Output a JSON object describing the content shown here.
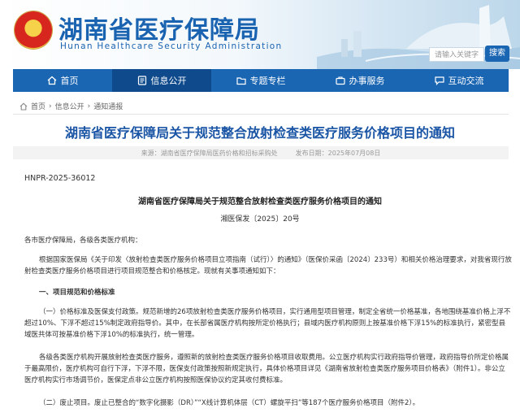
{
  "header": {
    "site_title": "湖南省医疗保障局",
    "site_subtitle": "Hunan Healthcare Security Administration",
    "search_placeholder": "请输入关键字",
    "search_button": "搜索"
  },
  "nav": {
    "items": [
      {
        "label": "首页",
        "icon": "home-icon"
      },
      {
        "label": "信息公开",
        "icon": "list-icon"
      },
      {
        "label": "专题专栏",
        "icon": "folder-icon"
      },
      {
        "label": "办事服务",
        "icon": "briefcase-icon"
      },
      {
        "label": "互动交流",
        "icon": "chat-icon"
      }
    ],
    "active_index": 1
  },
  "breadcrumb": {
    "items": [
      "首页",
      "信息公开",
      "通知通报"
    ],
    "separator": "›"
  },
  "article": {
    "title": "湖南省医疗保障局关于规范整合放射检查类医疗服务价格项目的通知",
    "source": "来源：湖南省医疗保障局医药价格和招标采购处",
    "date": "发布日期：2025年07月08日",
    "doc_number": "HNPR-2025-36012",
    "sub_title": "湖南省医疗保障局关于规范整合放射检查类医疗服务价格项目的通知",
    "file_number": "湘医保发〔2025〕20号",
    "salutation": "各市医疗保障局，各级各类医疗机构：",
    "para1": "根据国家医保局《关于印发〈放射检查类医疗服务价格项目立项指南（试行）〉的通知》（医保价采函〔2024〕233号）和相关价格治理要求，对我省现行放射检查类医疗服务价格项目进行项目规范整合和价格核定。现就有关事项通知如下：",
    "section1": "一、项目规范和价格标准",
    "para2": "（一）价格标准及医保支付政策。规范新增的26项放射检查类医疗服务价格项目，实行通用型项目管理，制定全省统一价格基准，各地围绕基准价格上浮不超过10%、下浮不超过15%制定政府指导价。其中，在长部省属医疗机构按所定价格执行；县域内医疗机构原则上按基准价格下浮15%的标准执行，紧密型县域医共体可按基准价格下浮10%的标准执行，统一管理。",
    "para3": "各级各类医疗机构开展放射检查类医疗服务，遵照新的放射检查类医疗服务价格项目收取费用。公立医疗机构实行政府指导价管理，政府指导价所定价格属于最高限价，医疗机构可自行下浮，下浮不限，医保支付政策按照新规定执行，具体价格项目详见《湖南省放射检查类医疗服务项目价格表》（附件1）。非公立医疗机构实行市场调节价，医保定点非公立医疗机构按照医保协议约定其收付费标准。",
    "para4": "（二）废止项目。废止已整合的“数字化摄影（DR）”“X线计算机体层（CT）螺旋平扫”等187个医疗服务价格项目（附件2）。"
  }
}
